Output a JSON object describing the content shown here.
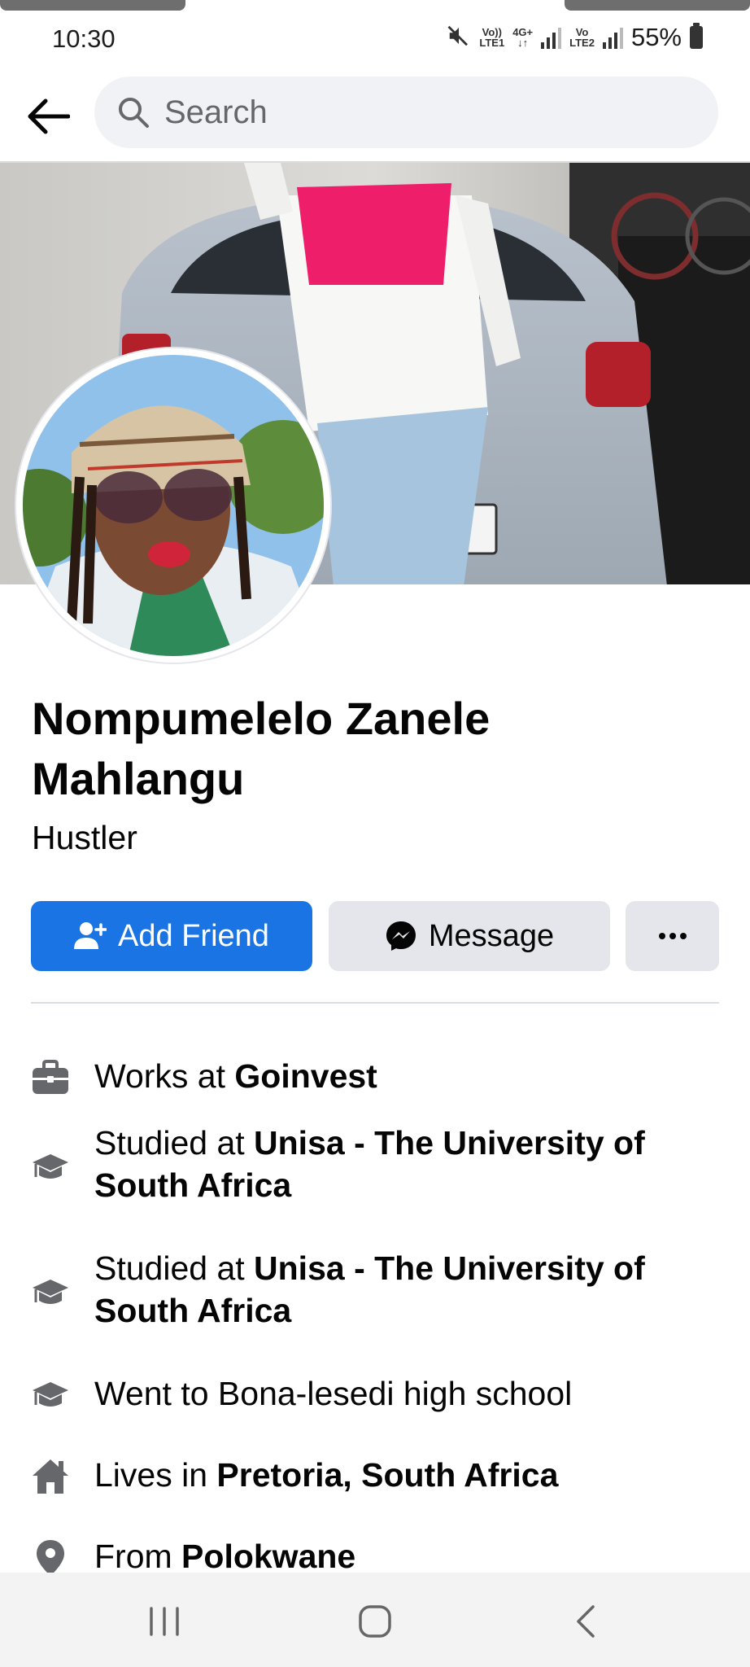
{
  "status_bar": {
    "time": "10:30",
    "volte1": "Vo))",
    "lte1": "LTE1",
    "net": "4G+",
    "volte2": "Vo",
    "lte2": "LTE2",
    "battery": "55%"
  },
  "search": {
    "placeholder": "Search"
  },
  "profile": {
    "name": "Nompumelelo Zanele Mahlangu",
    "bio": "Hustler"
  },
  "actions": {
    "add_friend": "Add Friend",
    "message": "Message"
  },
  "details": [
    {
      "icon": "briefcase-icon",
      "prefix": "Works at ",
      "bold": "Goinvest"
    },
    {
      "icon": "graduation-cap-icon",
      "prefix": "Studied at ",
      "bold": "Unisa - The University of South Africa"
    },
    {
      "icon": "graduation-cap-icon",
      "prefix": "Studied at ",
      "bold": "Unisa - The University of South Africa"
    },
    {
      "icon": "graduation-cap-icon",
      "prefix": "Went to Bona-lesedi high school",
      "bold": ""
    },
    {
      "icon": "home-icon",
      "prefix": "Lives in ",
      "bold": "Pretoria, South Africa"
    },
    {
      "icon": "location-pin-icon",
      "prefix": "From ",
      "bold": "Polokwane"
    }
  ],
  "colors": {
    "primary": "#1b74e4",
    "secondary_button": "#e4e6eb",
    "text": "#050505",
    "muted": "#65676b"
  }
}
